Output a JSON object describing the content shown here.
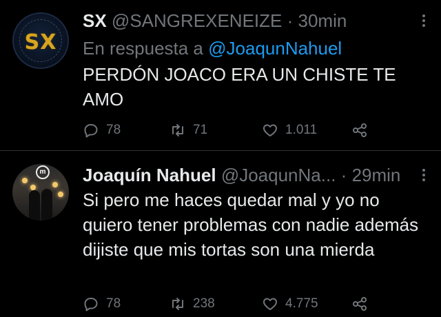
{
  "tweet1": {
    "name": "SX",
    "handle": "@SANGREXENEIZE",
    "separator": "·",
    "time": "30min",
    "reply_prefix": "En respuesta a",
    "reply_mention": "@JoaqunNahuel",
    "text": "PERDÓN JOACO ERA UN CHISTE TE AMO",
    "avatar_text": "SX",
    "replies": "78",
    "retweets": "71",
    "likes": "1.011"
  },
  "tweet2": {
    "name": "Joaquín Nahuel",
    "handle": "@JoaqunNa...",
    "separator": "·",
    "time": "29min",
    "text": "Si pero me haces quedar mal y yo no quiero tener problemas con nadie además dijiste que mis tortas son una mierda",
    "avatar_logo": "m",
    "replies": "78",
    "retweets": "238",
    "likes": "4.775"
  },
  "icons": {
    "reply": "reply-icon",
    "retweet": "retweet-icon",
    "like": "heart-icon",
    "share": "share-icon",
    "more": "more-options-icon"
  },
  "colors": {
    "background": "#000000",
    "text": "#e7e9ea",
    "secondary": "#71767b",
    "link": "#1d9bf0",
    "avatar_accent": "#d9a520"
  }
}
